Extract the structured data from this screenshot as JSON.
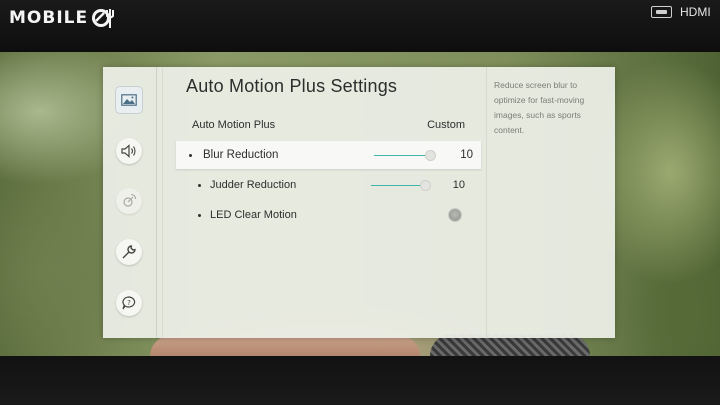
{
  "watermark": {
    "brand_text": "MOBILE"
  },
  "source": {
    "label": "HDMI",
    "icon": "hdmi-port-icon"
  },
  "sidebar": {
    "items": [
      {
        "name": "picture",
        "icon": "picture-icon",
        "active": true
      },
      {
        "name": "sound",
        "icon": "speaker-icon",
        "active": false
      },
      {
        "name": "broadcasting",
        "icon": "satellite-icon",
        "active": false,
        "disabled": true
      },
      {
        "name": "general",
        "icon": "wrench-icon",
        "active": false
      },
      {
        "name": "support",
        "icon": "help-bubble-icon",
        "active": false
      }
    ]
  },
  "panel": {
    "title": "Auto Motion Plus Settings",
    "auto_motion_plus": {
      "label": "Auto Motion Plus",
      "value": "Custom"
    },
    "blur_reduction": {
      "label": "Blur Reduction",
      "value": "10",
      "level": 1.0
    },
    "judder_reduction": {
      "label": "Judder Reduction",
      "value": "10",
      "level": 1.0
    },
    "led_clear_motion": {
      "label": "LED Clear Motion",
      "enabled": false
    }
  },
  "help": {
    "text": "Reduce screen blur to optimize for fast-moving images, such as sports content."
  },
  "colors": {
    "accent": "#3fb6a8",
    "panel_bg": "#eef0e8"
  }
}
